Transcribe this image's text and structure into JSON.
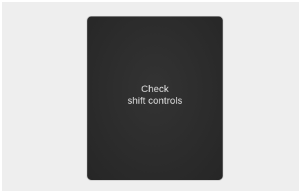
{
  "display": {
    "message_line1": "Check",
    "message_line2": "shift controls"
  }
}
